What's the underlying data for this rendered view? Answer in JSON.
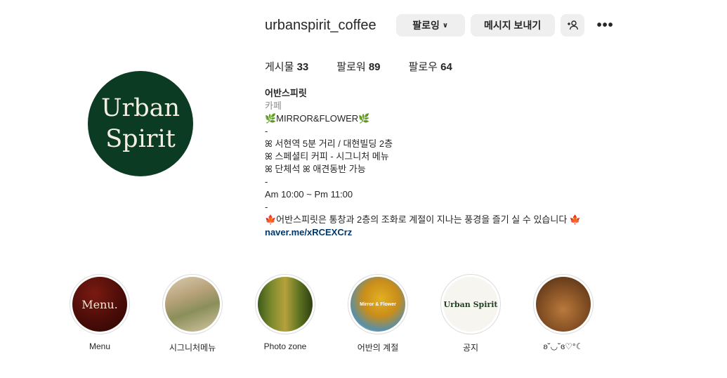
{
  "profile": {
    "username": "urbanspirit_coffee",
    "avatar_text": [
      "Urban",
      "Spirit"
    ],
    "avatar_color": "#0c3b24"
  },
  "actions": {
    "follow_label": "팔로잉",
    "follow_chevron": "∨",
    "message_label": "메시지 보내기",
    "suggest_icon": "+웃",
    "more_icon": "•••"
  },
  "stats": {
    "posts_label": "게시물",
    "posts_count": "33",
    "followers_label": "팔로워",
    "followers_count": "89",
    "following_label": "팔로우",
    "following_count": "64"
  },
  "bio": {
    "name": "어반스피릿",
    "category": "카페",
    "lines": [
      "🌿MIRROR&FLOWER🌿",
      "-",
      "ꕤ 서현역 5분 거리 / 대현빌딩 2층",
      "ꕤ 스페셜티 커피 - 시그니처 메뉴",
      "ꕤ 단체석 ꕤ 애견동반 가능",
      "-",
      "Am 10:00 ~ Pm 11:00",
      "-",
      "🍁어반스피릿은 통창과 2층의 조화로 계절이 지나는 풍경을 즐기 실 수 있습니다 🍁"
    ],
    "link": "naver.me/xRCEXCrz"
  },
  "highlights": [
    {
      "label": "Menu",
      "thumb_text": "Menu."
    },
    {
      "label": "시그니처메뉴",
      "thumb_text": ""
    },
    {
      "label": "Photo zone",
      "thumb_text": ""
    },
    {
      "label": "어반의 계절",
      "thumb_text": "Mirror & Flower"
    },
    {
      "label": "공지",
      "thumb_text": "Urban Spirit"
    },
    {
      "label": "ʚ˘◡˘ɞ♡°☾",
      "thumb_text": ""
    }
  ]
}
